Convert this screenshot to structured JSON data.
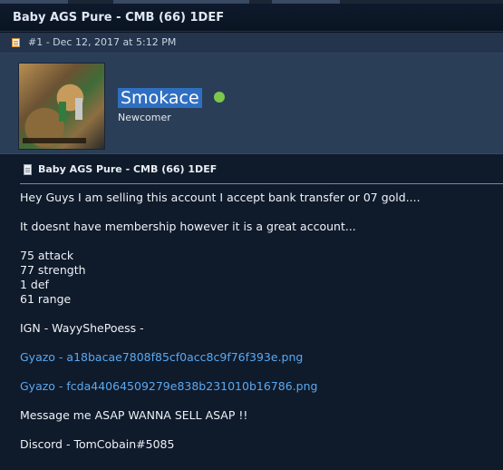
{
  "thread": {
    "title": "Baby AGS Pure - CMB (66) 1DEF"
  },
  "post_meta": {
    "text": "#1 - Dec 12, 2017 at 5:12 PM"
  },
  "user": {
    "name": "Smokace",
    "rank": "Newcomer",
    "status_color": "#7cc84a"
  },
  "post": {
    "title": "Baby AGS Pure - CMB (66) 1DEF",
    "lines": [
      "Hey Guys I am selling this account I accept bank transfer or 07 gold....",
      "It doesnt have membership however it is a great account...",
      "75 attack",
      "77 strength",
      "1 def",
      "61 range",
      "IGN - WayyShePoess -",
      "Gyazo - a18bacae7808f85cf0acc8c9f76f393e.png",
      "Gyazo - fcda44064509279e838b231010b16786.png",
      "Message me ASAP WANNA SELL ASAP !!",
      "Discord - TomCobain#5085"
    ]
  },
  "colors": {
    "link": "#5aa9f0",
    "highlight": "#2f6fc2"
  }
}
